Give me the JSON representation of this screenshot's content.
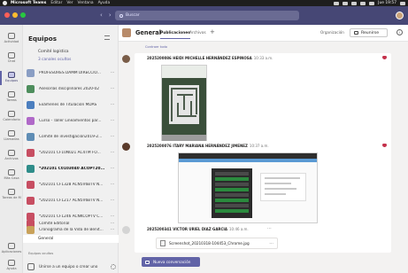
{
  "menubar": {
    "app": "Microsoft Teams",
    "items": [
      "Editar",
      "Ver",
      "Ventana",
      "Ayuda"
    ],
    "clock": "Jue 19:57"
  },
  "titlebar": {
    "search_placeholder": "Buscar",
    "nav_back": "‹",
    "nav_forward": "›",
    "colors": {
      "bar": "#464775",
      "close": "#ff5f57",
      "minimize": "#febc2e",
      "zoom": "#28c840"
    }
  },
  "rail": {
    "items": [
      {
        "label": "Actividad",
        "icon": "bell-icon"
      },
      {
        "label": "Chat",
        "icon": "chat-icon"
      },
      {
        "label": "Equipos",
        "icon": "teams-icon"
      },
      {
        "label": "Tareas",
        "icon": "tasks-icon"
      },
      {
        "label": "Calendario",
        "icon": "calendar-icon"
      },
      {
        "label": "Llamadas",
        "icon": "phone-icon"
      },
      {
        "label": "Archivos",
        "icon": "files-icon"
      },
      {
        "label": "Más Casa",
        "icon": "more-icon"
      },
      {
        "label": "Tareas de M",
        "icon": "app-icon"
      }
    ],
    "bottom": {
      "label": "Aplicaciones",
      "icon": "apps-icon"
    },
    "help": {
      "label": "Ayuda",
      "icon": "help-icon"
    }
  },
  "teams_panel": {
    "title": "Equipos",
    "top_items": [
      "Comité logística",
      "3 canales ocultos"
    ],
    "teams": [
      {
        "label": "PROFESORES DAMM DIRECCIO...",
        "color": "#8a9ec4",
        "bold": false
      },
      {
        "label": "Asesorías disciplinares 2020-02",
        "color": "#4e8e5d",
        "bold": false
      },
      {
        "label": "Exámenes de Titulación MDAS",
        "color": "#4c7fbf",
        "bold": false
      },
      {
        "label": "Curso - Taller Lineamientos par...",
        "color": "#b069c8",
        "bold": false
      },
      {
        "label": "Comité de investigación2019-2...",
        "color": "#5f8db5",
        "bold": false
      },
      {
        "label": "*202101 CF10N021 AC4TM FO...",
        "color": "#c74e62",
        "bold": false
      },
      {
        "label": "*202101 C0103040 ACOPT20...",
        "color": "#2f8d8a",
        "bold": true
      },
      {
        "label": "*202101 CF1328 ACN5V6BTV N...",
        "color": "#c74e62",
        "bold": false
      },
      {
        "label": "*202101 CF1217 ACN5V6BTV N...",
        "color": "#c74e62",
        "bold": false
      },
      {
        "label": "*202101 CF1246 ACNKCOPTV C...",
        "color": "#c74e62",
        "bold": false
      },
      {
        "label": "Comité Editorial",
        "color": "#c74e62",
        "bold": false
      },
      {
        "label": "Cronograma de la Vida de Benit...",
        "color": "#c9a25a",
        "bold": false
      }
    ],
    "selected_channel": "General",
    "hidden_teams_label": "Equipos ocultos",
    "join_label": "Unirse a un equipo o crear uno"
  },
  "channel": {
    "name": "General",
    "tabs": [
      "Publicaciones",
      "Archivos"
    ],
    "active_tab": "Publicaciones",
    "org_label": "Organización",
    "meet_label": "Reunirse",
    "team_icon_color": "#b88b6a"
  },
  "feed": {
    "collapse_label": "Contraer todo",
    "posts": [
      {
        "author": "2025200086 HEIDI MICHELLE HERNÁNDEZ ESPINOSA",
        "time": "10:33 a.m.",
        "avatar_color": "#7a5d48",
        "liked": true
      },
      {
        "author": "2025200076 ITARY MARIANA HERNÁNDEZ JIMENEZ",
        "time": "10:37 a.m.",
        "avatar_color": "#5a3a2a",
        "liked": true
      },
      {
        "author": "2025200341 VICTOR URIEL DIAZ GARCIA",
        "time": "10:46 a.m.",
        "avatar_color": "#d4d4d4",
        "liked": false,
        "attachment": "Screenshot_20210318-104453_Chrome.jpg"
      }
    ],
    "new_conversation": "Nueva conversación",
    "accent": "#6264a7"
  }
}
